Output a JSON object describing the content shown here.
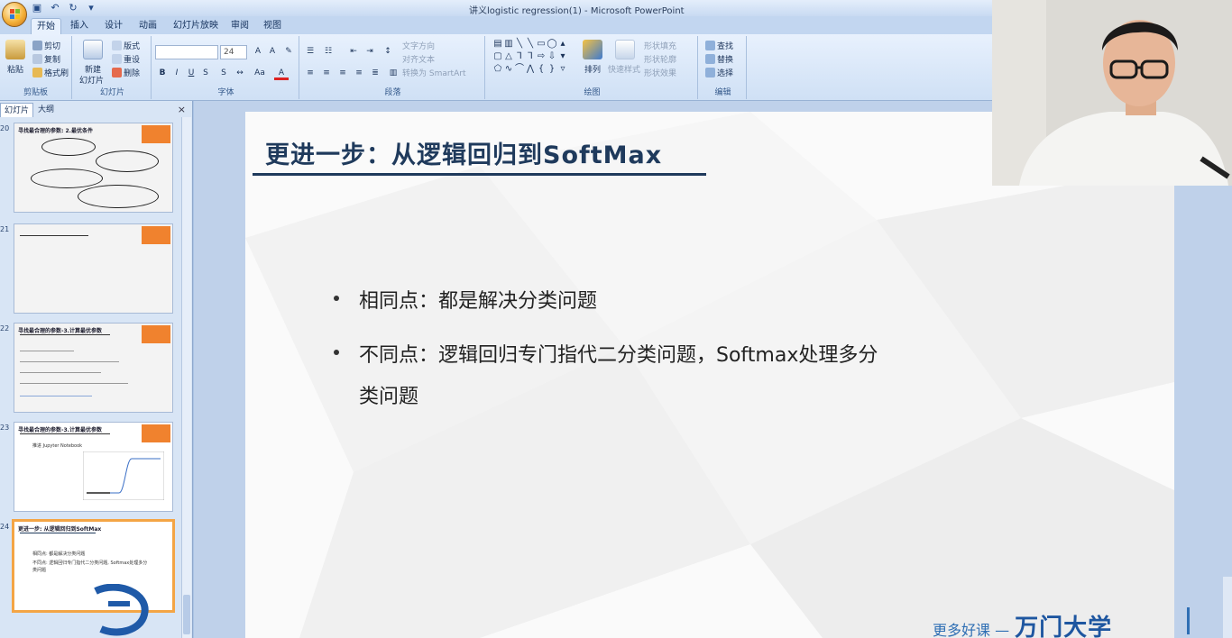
{
  "window": {
    "title": "讲义logistic regression(1) - Microsoft PowerPoint"
  },
  "ribbon": {
    "tabs": [
      "开始",
      "插入",
      "设计",
      "动画",
      "幻灯片放映",
      "审阅",
      "视图"
    ],
    "clipboard": {
      "label": "剪贴板",
      "paste": "粘贴",
      "cut": "剪切",
      "copy": "复制",
      "format_painter": "格式刷"
    },
    "slides": {
      "label": "幻灯片",
      "new_slide": "新建\n幻灯片",
      "new_slide_1": "新建",
      "new_slide_2": "幻灯片",
      "layout": "版式",
      "reset": "重设",
      "delete": "删除"
    },
    "font": {
      "label": "字体",
      "font_name": "",
      "font_size": "24"
    },
    "paragraph": {
      "label": "段落",
      "text_direction": "文字方向",
      "align_text": "对齐文本",
      "convert_smartart": "转换为 SmartArt"
    },
    "drawing": {
      "label": "绘图",
      "arrange": "排列",
      "quick_styles": "快速样式",
      "shape_fill": "形状填充",
      "shape_outline": "形状轮廓",
      "shape_effects": "形状效果"
    },
    "editing": {
      "label": "编辑",
      "find": "查找",
      "replace": "替换",
      "select": "选择"
    }
  },
  "panel": {
    "tabs": [
      "幻灯片",
      "大纲"
    ],
    "close_label": "×",
    "thumbnails": [
      {
        "number": "20",
        "title": "寻找最合理的参数: 2.最优条件"
      },
      {
        "number": "21",
        "title": ""
      },
      {
        "number": "22",
        "title": "寻找最合理的参数-3.计算最优参数"
      },
      {
        "number": "23",
        "title": "寻找最合理的参数-3.计算最优参数",
        "sub": "推进 Jupyter Notebook"
      },
      {
        "number": "24",
        "title": "更进一步: 从逻辑回归到SoftMax",
        "b1": "相同点: 都是解决分类问题",
        "b2": "不同点: 逻辑回归专门指代二分类问题, Softmax处理多分",
        "b3": "类问题"
      }
    ]
  },
  "slide": {
    "title": "更进一步：从逻辑回归到SoftMax",
    "bullets": [
      {
        "text": "相同点：都是解决分类问题"
      },
      {
        "text_line1": "不同点：逻辑回归专门指代二分类问题，Softmax处理多分",
        "text_line2": "类问题"
      }
    ]
  },
  "watermark": {
    "prefix": "更多好课 —",
    "brand": "万门大学"
  },
  "colors": {
    "accent_orange": "#f0822e",
    "title_navy": "#1f3a5c",
    "watermark_blue": "#2f6fb4",
    "ribbon_bg": "#dbe7f7"
  }
}
